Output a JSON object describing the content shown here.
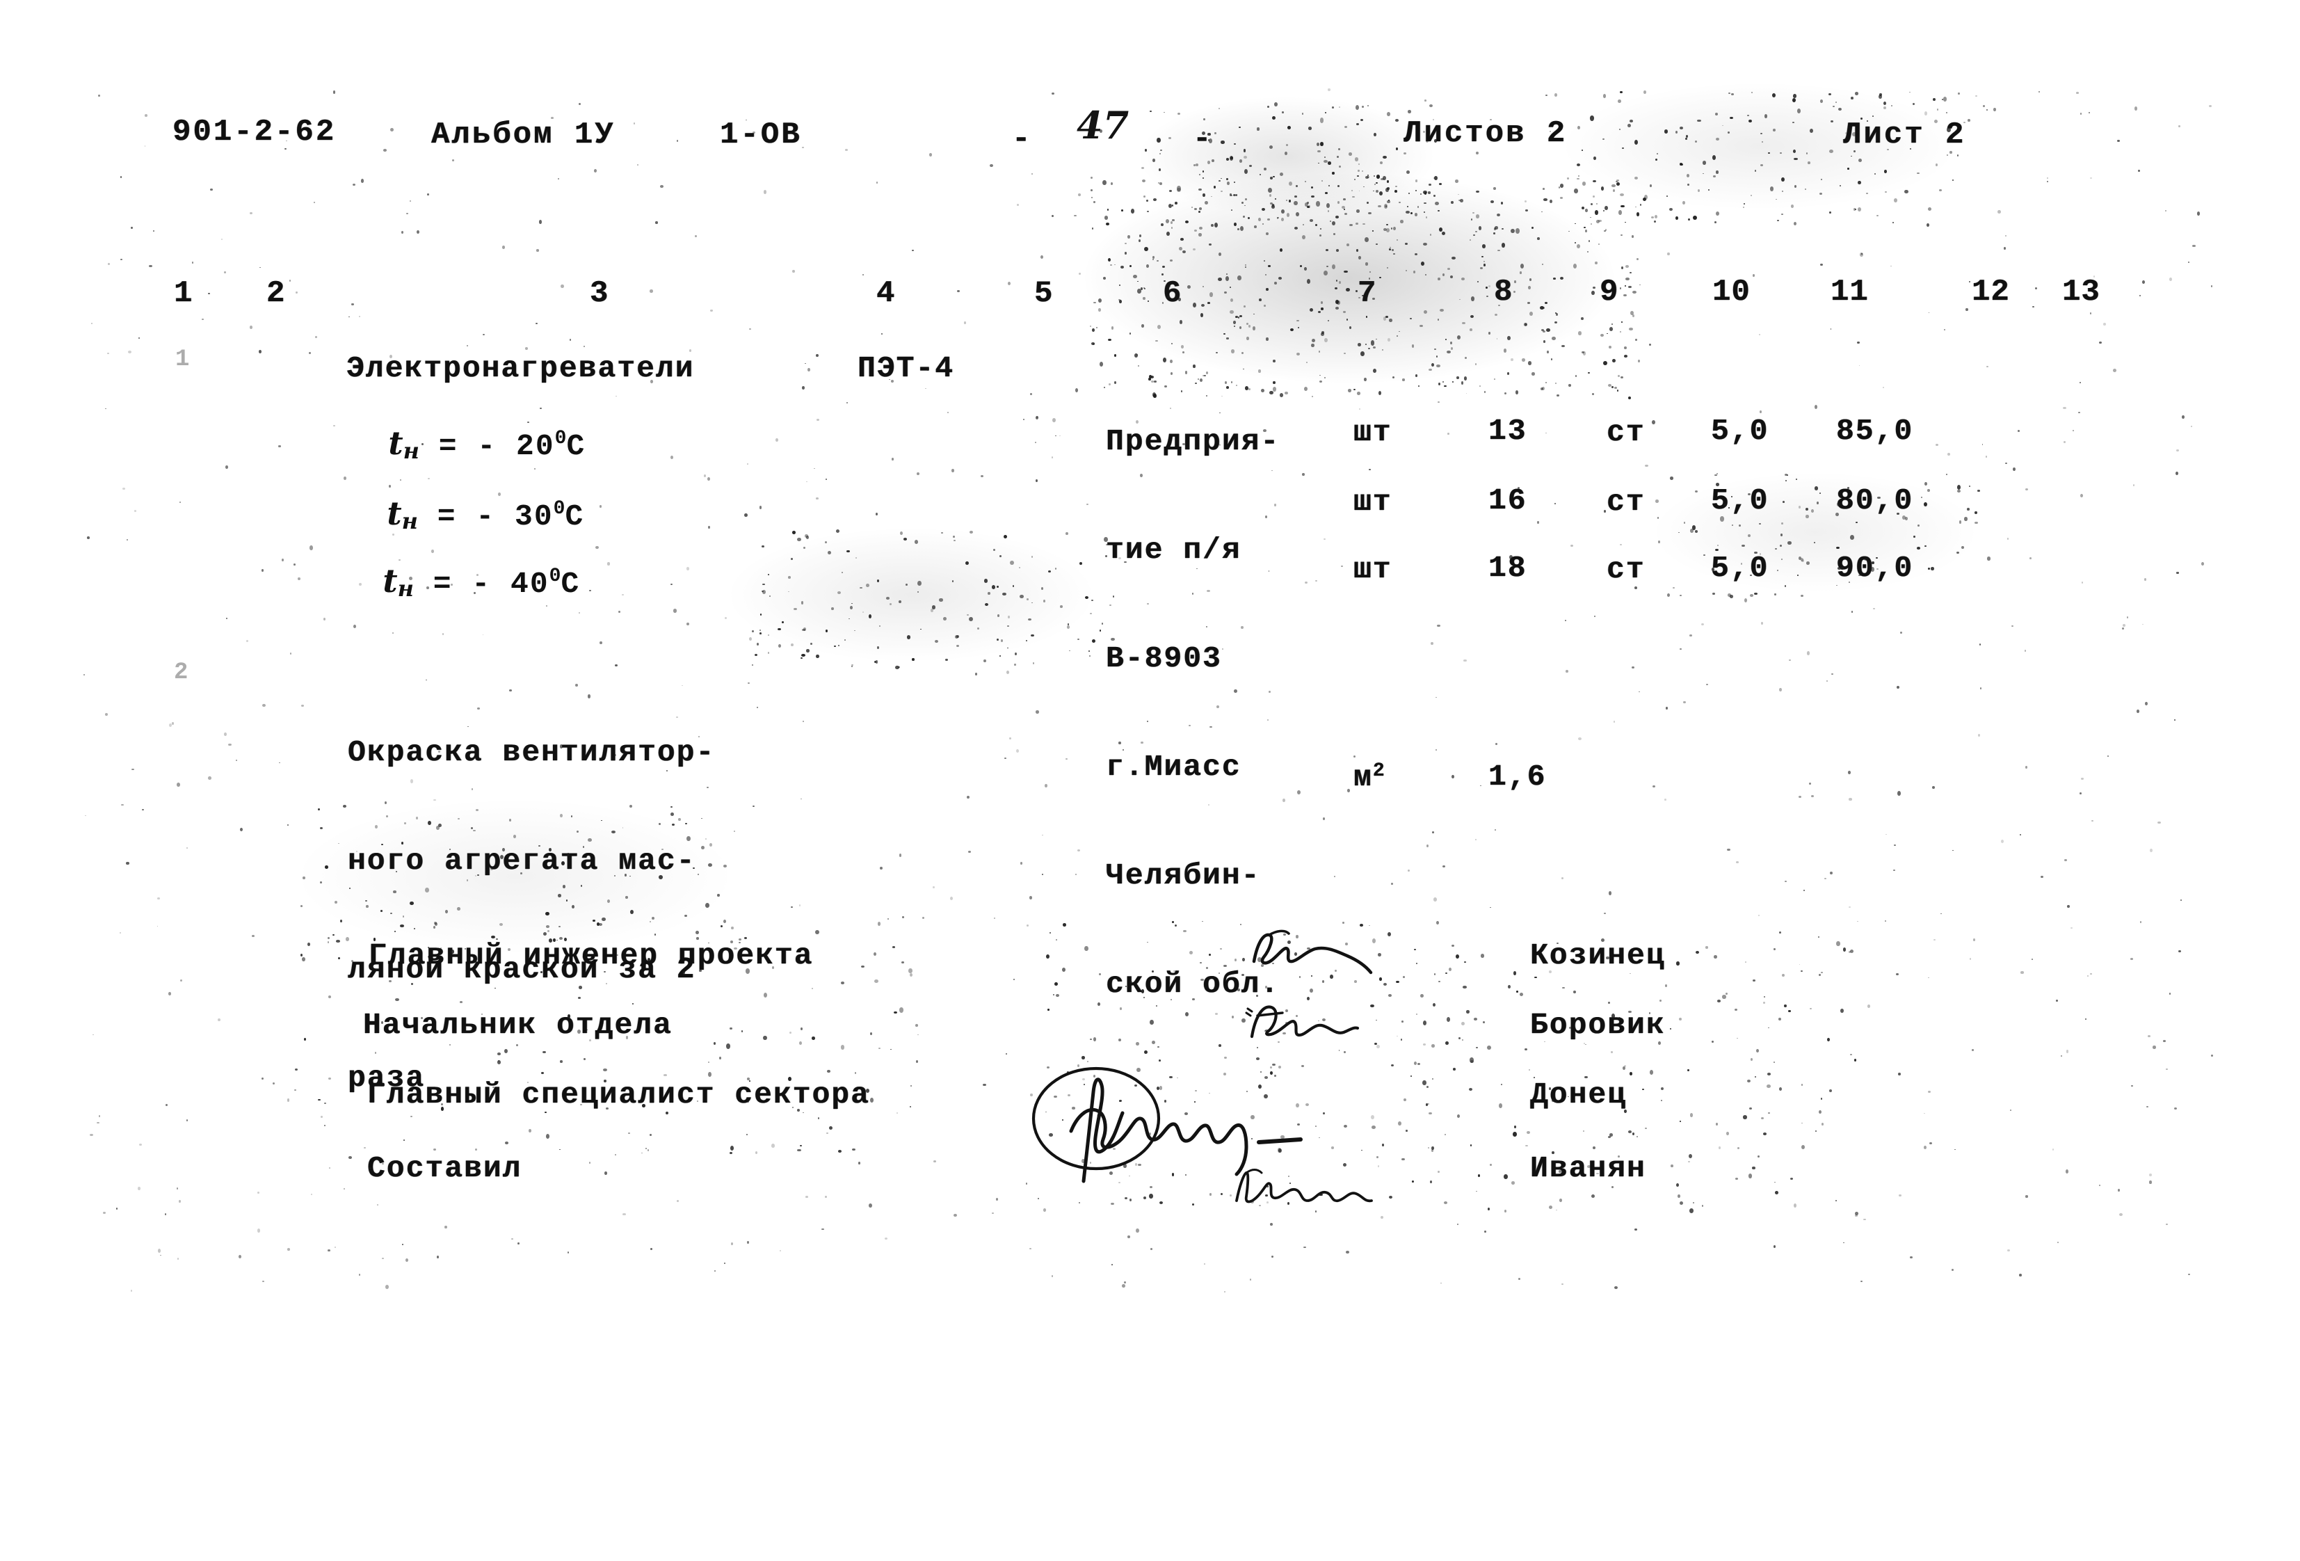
{
  "header": {
    "project_code": "901-2-62",
    "album": "Альбом 1У",
    "section": "1-ОВ",
    "page_dash_left": "-",
    "page_number": "47",
    "page_dash_right": "-",
    "sheets_total": "Листов 2",
    "sheet_current": "Лист 2"
  },
  "column_numbers": [
    "1",
    "2",
    "3",
    "4",
    "5",
    "6",
    "7",
    "8",
    "9",
    "10",
    "11",
    "12",
    "13"
  ],
  "rows": {
    "item_heaters": {
      "name": "Электронагреватели",
      "type": "ПЭТ-4",
      "supplier_lines": [
        "Предприя-",
        "тие п/я",
        "В-8903",
        "г.Миасс",
        "Челябин-",
        "ской обл."
      ],
      "sub_rows": [
        {
          "temp_prefix": "t",
          "temp_sub": "н",
          "temp_eq": "=",
          "temp_value": "- 20",
          "temp_deg": "0",
          "temp_unit": "C",
          "unit": "шт",
          "qty": "13",
          "material": "ст",
          "mass_unit": "5,0",
          "mass_total": "85,0"
        },
        {
          "temp_prefix": "t",
          "temp_sub": "н",
          "temp_eq": "=",
          "temp_value": "- 30",
          "temp_deg": "0",
          "temp_unit": "C",
          "unit": "шт",
          "qty": "16",
          "material": "ст",
          "mass_unit": "5,0",
          "mass_total": "80,0"
        },
        {
          "temp_prefix": "t",
          "temp_sub": "н",
          "temp_eq": "=",
          "temp_value": "- 40",
          "temp_deg": "0",
          "temp_unit": "C",
          "unit": "шт",
          "qty": "18",
          "material": "ст",
          "mass_unit": "5,0",
          "mass_total": "90,0"
        }
      ]
    },
    "item_painting": {
      "description_lines": [
        "Окраска вентилятор-",
        "ного агрегата мас-",
        "ляной краской за 2",
        "раза"
      ],
      "unit": "м",
      "unit_exp": "2",
      "qty": "1,6"
    }
  },
  "signatures": {
    "entries": [
      {
        "role": "Главный инженер проекта",
        "name": "Козинец"
      },
      {
        "role": "Начальник отдела",
        "name": "Боровик"
      },
      {
        "role": "Главный специалист сектора",
        "name": "Донец"
      },
      {
        "role": "Составил",
        "name": "Иванян"
      }
    ]
  },
  "margin_marks": [
    "1",
    "2"
  ],
  "colors": {
    "paper": "#ffffff",
    "ink": "#101010",
    "faint_ink": "#6a6a6a"
  }
}
